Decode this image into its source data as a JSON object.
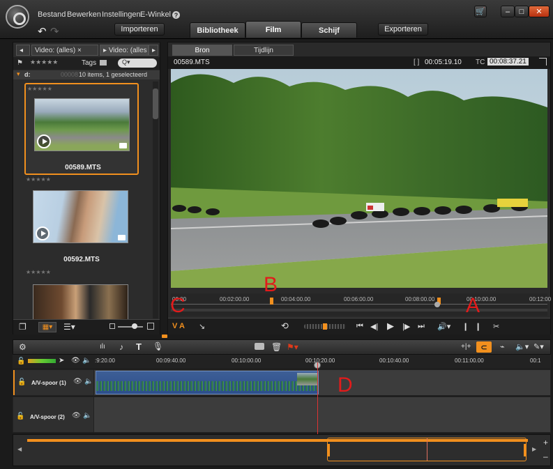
{
  "menu": {
    "items": [
      "Bestand",
      "Bewerken",
      "Instellingen",
      "E-Winkel"
    ]
  },
  "header": {
    "import_label": "Importeren",
    "export_label": "Exporteren",
    "tabs": [
      {
        "label": "Bibliotheek",
        "active": false
      },
      {
        "label": "Film",
        "active": true
      },
      {
        "label": "Schijf",
        "active": false
      }
    ]
  },
  "library": {
    "tabs": [
      "Video: (alles)",
      "Video: (alles"
    ],
    "tags_label": "Tags",
    "search_placeholder": "Q▾",
    "folder_name": "d:",
    "folder_count": "00008",
    "folder_status": "10 items, 1 geselecteerd",
    "items": [
      {
        "label": "00589.MTS",
        "selected": true
      },
      {
        "label": "00592.MTS",
        "selected": false
      },
      {
        "label": "",
        "selected": false
      }
    ]
  },
  "player": {
    "tabs": [
      {
        "label": "Bron",
        "active": true
      },
      {
        "label": "Tijdlijn",
        "active": false
      }
    ],
    "filename": "00589.MTS",
    "duration": "00:05:19.10",
    "tc_label": "TC",
    "timecode": "00:08:37.21",
    "ruler_ticks": [
      "00:00",
      "00:02:00.00",
      "00:04:00.00",
      "00:06:00.00",
      "00:08:00.00",
      "00:10:00.00",
      "00:12:00"
    ],
    "ctrl_va": "V A"
  },
  "timeline": {
    "ruler_ticks": [
      ":9:20.00",
      "00:09:40.00",
      "00:10:00.00",
      "00:10:20.00",
      "00:10:40.00",
      "00:11:00.00",
      "00:1"
    ],
    "tracks": [
      {
        "name": "A/V-spoor (1)"
      },
      {
        "name": "A/V-spoor (2)"
      }
    ]
  },
  "annotations": {
    "a": "A",
    "b": "B",
    "c": "C",
    "d": "D"
  },
  "colors": {
    "accent": "#f2901e",
    "annotation": "#e21b1b",
    "clip_blue": "#2d4f8c"
  }
}
